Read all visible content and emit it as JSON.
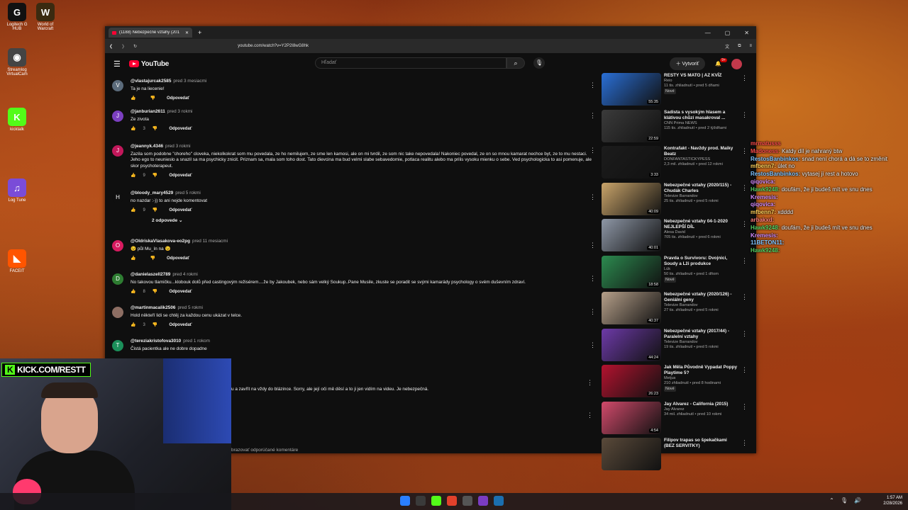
{
  "desktop": {
    "icons": [
      {
        "label": "Logitech G HUB",
        "glyph": "G",
        "color": "#111111"
      },
      {
        "label": "World of Warcraft",
        "glyph": "W",
        "color": "#3a2a10"
      },
      {
        "label": "Streamlog VirtualCam",
        "glyph": "◉",
        "color": "#444444"
      },
      {
        "label": "kicktalk",
        "glyph": "K",
        "color": "#53fc18"
      },
      {
        "label": "Log Tune",
        "glyph": "♫",
        "color": "#7a4cd8"
      },
      {
        "label": "FACEIT",
        "glyph": "◣",
        "color": "#ff5500"
      }
    ]
  },
  "browser": {
    "tab_title": "(1188) Nebezpečné vztahy (201",
    "url": "youtube.com/watch?v=Y2P2I8wG8hk"
  },
  "youtube": {
    "logo_text": "YouTube",
    "search_placeholder": "Hľadať",
    "create_label": "Vytvoriť",
    "notif_count": "9+",
    "reply_label": "Odpovedať",
    "comments": [
      {
        "user": "@vlastajurcak2585",
        "age": "pred 3 mesiacmi",
        "text": "Ta je na liecenie!",
        "likes": "",
        "avatar": "V",
        "color": "#5b6b7b"
      },
      {
        "user": "@janburian2611",
        "age": "pred 3 rokmi",
        "text": "Ze zivota",
        "likes": "3",
        "avatar": "J",
        "color": "#7b3fc0"
      },
      {
        "user": "@jeannyk.4346",
        "age": "pred 3 rokmi",
        "text": "Zazila som podobne \"choreho\" cloveka, niekolkokrat som mu povedala, ze ho nemilujem, ze sme len kamosi, ale on mi tvrdil, ze som nic take nepovedala! Nakoniec povedal, ze on so mnou kamarat nechce byt, ze to mu nestaci. Jeho ego to neunieslo a snazil sa ma psychicky znicit. Priznam sa, mala som toho dost. Tato dievcina ma bud velmi slabe sebavedomie, potlaca realitu alebo ma prilis vysoku mienku o sebe. Ved psychologicka to asi pomenuje, ale skor psychoterapeut.",
        "likes": "9",
        "avatar": "J",
        "color": "#c2185b"
      },
      {
        "user": "@bloody_mary4529",
        "age": "pred 5 rokmi",
        "text": "no nazdar :-)) to ani nejde komentovat",
        "likes": "9",
        "avatar": "H",
        "color": "#0f0f0f",
        "replies": "2 odpovede"
      },
      {
        "user": "@OldriskaVlasakova-eo2pg",
        "age": "pred 11 mesiacmi",
        "text": "😉 půl Mu_ín na 😉",
        "likes": "",
        "avatar": "O",
        "color": "#d81b60"
      },
      {
        "user": "@danielaszell2789",
        "age": "pred 4 rokmi",
        "text": "No takovou tlamičku...klobouk dolů před castingovým režisérem....že by Jakoubek, nebo sám velký Soukup..Pane Musile, zkuste se poradit se svými kamarády psychology o svém duševním zdraví.",
        "likes": "8",
        "avatar": "D",
        "color": "#2e7d32"
      },
      {
        "user": "@martinmacalik2506",
        "age": "pred 5 rokmi",
        "text": "Hold někteří lidi se chtěj za každou cenu ukázat v telce.",
        "likes": "3",
        "avatar": "",
        "color": "#8d6e63"
      },
      {
        "user": "@tereziakristofova3010",
        "age": "pred 1 rokom",
        "text": "Čistá pacientka ale ne dobre dopadne",
        "likes": "",
        "avatar": "T",
        "color": "#1b8f5a"
      }
    ],
    "partial_comment_text": "u a zavřít na vždy do blázince. Sorry, ale její oči mě děsí a to ji jen vidím na videu. Je nebezpečná.",
    "bottom_note": "brazovať odporúčané komentáre",
    "videos": [
      {
        "title": "RESTY VS MATO | AZ KVÍZ",
        "channel": "Reio",
        "views": "11 tis. zhliadnutí",
        "age": "pred 5 dňami",
        "duration": "55:35",
        "new": "Nové",
        "thumb": "#2a6fd6"
      },
      {
        "title": "Sadista s vysokým hlasem a klátivou chůzí masakroval ...",
        "channel": "CNN Prima NEWS",
        "views": "115 tis. zhliadnutí",
        "age": "pred 2 týždňami",
        "duration": "22:59",
        "new": "",
        "thumb": "#3b3b3b"
      },
      {
        "title": "Kontrafakt - Navždy prod. Maiky Beatz",
        "channel": "DONFANTASTICKYPESS",
        "views": "2,3 mil. zhliadnutí",
        "age": "pred 12 rokmi",
        "duration": "3:33",
        "new": "",
        "thumb": "#1c1c1c"
      },
      {
        "title": "Nebezpečné vztahy (2020/115) - Chudák Charles",
        "channel": "Televize Barrandov",
        "views": "25 tis. zhliadnutí",
        "age": "pred 5 rokmi",
        "duration": "40:09",
        "new": "",
        "thumb": "#c9a46a"
      },
      {
        "title": "Nebezpečné vztahy 04-1-2020 NEJLEPŠÍ DÍL",
        "channel": "Alesa David",
        "views": "705 tis. zhliadnutí",
        "age": "pred 6 rokmi",
        "duration": "40:01",
        "new": "",
        "thumb": "#8e97a6"
      },
      {
        "title": "Pravda o Survivoru: Dvojnici, Soudy a Lži produkce",
        "channel": "Lük",
        "views": "50 tis. zhliadnutí",
        "age": "pred 1 dňom",
        "duration": "18:58",
        "new": "Nové",
        "thumb": "#2c8a4f"
      },
      {
        "title": "Nebezpečné vztahy (2020/126) - Geniální geny",
        "channel": "Televize Barrandov",
        "views": "27 tis. zhliadnutí",
        "age": "pred 5 rokmi",
        "duration": "40:37",
        "new": "",
        "thumb": "#b6a08a"
      },
      {
        "title": "Nebezpečné vztahy (2017/44) - Paralelní vztahy",
        "channel": "Televize Barrandov",
        "views": "19 tis. zhliadnutí",
        "age": "pred 5 rokmi",
        "duration": "44:24",
        "new": "",
        "thumb": "#6d3aa8"
      },
      {
        "title": "Jak Měla Původně Vypadat Poppy Playtime 5?",
        "channel": "Metjus",
        "views": "210 zhliadnutí",
        "age": "pred 8 hodinami",
        "duration": "26:23",
        "new": "Nové",
        "thumb": "#b3122f"
      },
      {
        "title": "Jay Alvarez - California (2015)",
        "channel": "Jay Alvarez",
        "views": "34 mil. zhliadnutí",
        "age": "pred 10 rokmi",
        "duration": "4:54",
        "new": "",
        "thumb": "#d14a6b"
      },
      {
        "title": "Filipov trapas so špekačkami (BEZ SERVITKY)",
        "channel": "",
        "views": "",
        "age": "",
        "duration": "",
        "new": "",
        "thumb": "#5a4a3a"
      }
    ]
  },
  "chat": [
    {
      "user": "mrmatusss",
      "text": "",
      "cls": "n1"
    },
    {
      "user": "Madoness:",
      "text": "Katdy díl je nahraný btw",
      "cls": "n1"
    },
    {
      "user": "RestosBanbinkos:",
      "text": "snad není chorá a dá se to změnit",
      "cls": "n2"
    },
    {
      "user": "mfbenn7:",
      "text": "úlet no",
      "cls": "n5"
    },
    {
      "user": "RestosBanbinkos:",
      "text": "vytasej ji rest a hotovo",
      "cls": "n2"
    },
    {
      "user": "qiqovica:",
      "text": "",
      "cls": "n4"
    },
    {
      "user": "Hawk9248:",
      "text": "doufám, že ji budeš mít ve snu dnes",
      "cls": "n3"
    },
    {
      "user": "Kremesis:",
      "text": "",
      "cls": "n4"
    },
    {
      "user": "qiqovica:",
      "text": "",
      "cls": "n4"
    },
    {
      "user": "mfbenn7:",
      "text": "xdddd",
      "cls": "n5"
    },
    {
      "user": "arbakxd:",
      "text": "",
      "cls": "n6"
    },
    {
      "user": "Hawk9248:",
      "text": "doufám, že ji budeš mít ve snu dnes",
      "cls": "n3"
    },
    {
      "user": "Kremesis:",
      "text": "",
      "cls": "n4"
    },
    {
      "user": "11BETON11:",
      "text": "",
      "cls": "n2"
    },
    {
      "user": "Hawk9248:",
      "text": "",
      "cls": "n3"
    }
  ],
  "overlay": {
    "kick_text": "KICK.COM/RESTT"
  },
  "taskbar": {
    "time": "1:57 AM",
    "date": "2/28/2026"
  }
}
